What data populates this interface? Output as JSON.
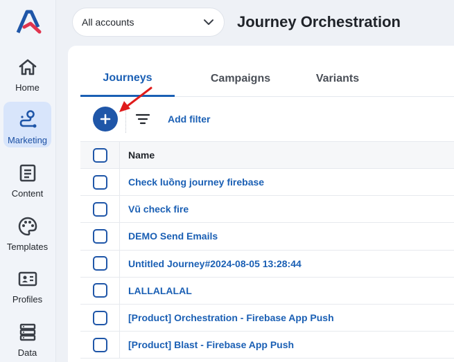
{
  "sidebar": {
    "items": [
      {
        "label": "Home",
        "icon": "home-icon"
      },
      {
        "label": "Marketing",
        "icon": "route-icon",
        "active": true
      },
      {
        "label": "Content",
        "icon": "document-icon"
      },
      {
        "label": "Templates",
        "icon": "palette-icon"
      },
      {
        "label": "Profiles",
        "icon": "id-card-icon"
      },
      {
        "label": "Data",
        "icon": "database-icon"
      }
    ]
  },
  "header": {
    "account_select": "All accounts",
    "title": "Journey Orchestration"
  },
  "tabs": [
    {
      "label": "Journeys",
      "active": true
    },
    {
      "label": "Campaigns"
    },
    {
      "label": "Variants"
    }
  ],
  "toolbar": {
    "add_filter": "Add filter"
  },
  "table": {
    "columns": [
      "Name"
    ],
    "rows": [
      "Check luồng journey firebase",
      "Vũ check fire",
      "DEMO Send Emails",
      "Untitled Journey#2024-08-05 13:28:44",
      "LALLALALAL",
      "[Product] Orchestration - Firebase App Push",
      "[Product] Blast - Firebase App Push"
    ]
  },
  "colors": {
    "accent": "#1f56a8",
    "link": "#1a5fb4",
    "annotation_arrow": "#e01b1b"
  }
}
